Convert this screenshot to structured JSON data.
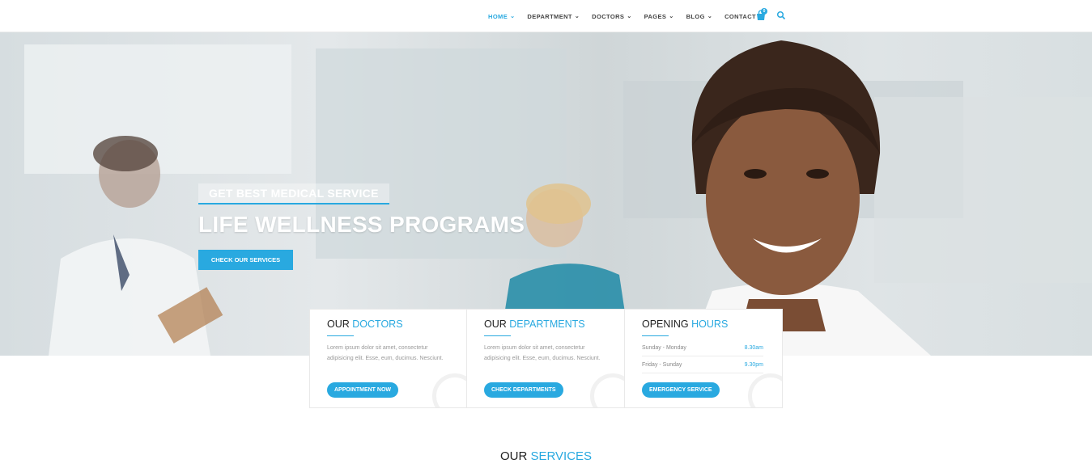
{
  "nav": {
    "items": [
      {
        "label": "HOME",
        "has_dropdown": true,
        "active": true
      },
      {
        "label": "DEPARTMENT",
        "has_dropdown": true,
        "active": false
      },
      {
        "label": "DOCTORS",
        "has_dropdown": true,
        "active": false
      },
      {
        "label": "PAGES",
        "has_dropdown": true,
        "active": false
      },
      {
        "label": "BLOG",
        "has_dropdown": true,
        "active": false
      },
      {
        "label": "CONTACT",
        "has_dropdown": false,
        "active": false
      }
    ],
    "cart_count": "0",
    "cart_icon": "shopping-bag-icon",
    "search_icon": "search-icon"
  },
  "hero": {
    "tagline": "GET BEST MEDICAL SERVICE",
    "title": "LIFE WELLNESS PROGRAMS",
    "button": "CHECK OUR SERVICES"
  },
  "cards": [
    {
      "title_plain": "OUR",
      "title_highlight": "DOCTORS",
      "text": "Lorem ipsum dolor sit amet, consectetur adipisicing elit. Esse, eum, ducimus. Nesciunt.",
      "button": "APPOINTMENT NOW"
    },
    {
      "title_plain": "OUR",
      "title_highlight": "DEPARTMENTS",
      "text": "Lorem ipsum dolor sit amet, consectetur adipisicing elit. Esse, eum, ducimus. Nesciunt.",
      "button": "CHECK DEPARTMENTS"
    },
    {
      "title_plain": "OPENING",
      "title_highlight": "HOURS",
      "hours": [
        {
          "days": "Sunday - Monday",
          "time": "8.30am"
        },
        {
          "days": "Friday - Sunday",
          "time": "9.30pm"
        }
      ],
      "button": "EMERGENCY SERVICE"
    }
  ],
  "services": {
    "title_plain": "OUR",
    "title_highlight": "SERVICES"
  },
  "colors": {
    "accent": "#29a9e0",
    "text_dark": "#222222",
    "text_muted": "#999999"
  }
}
